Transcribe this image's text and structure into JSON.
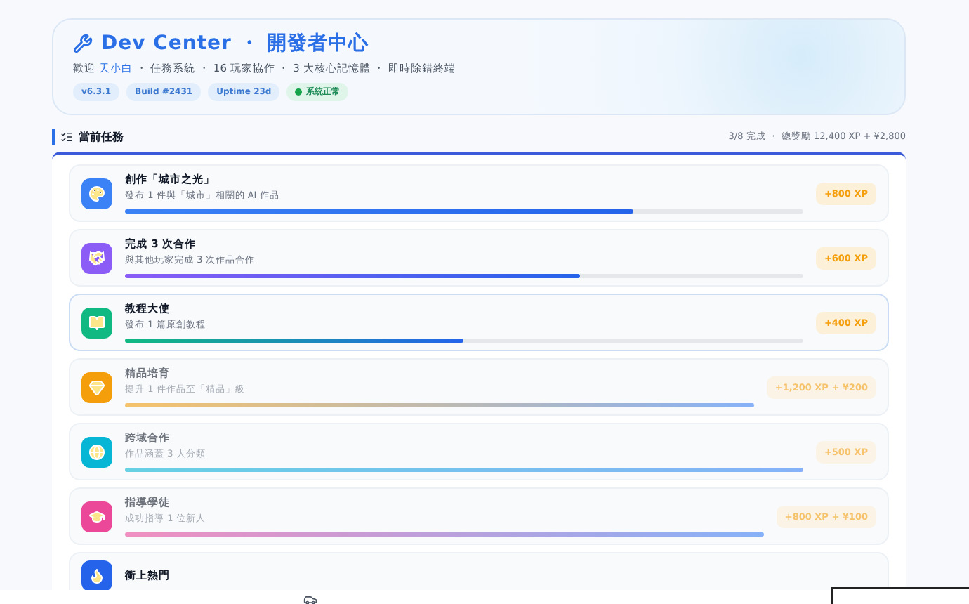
{
  "header": {
    "title": "Dev Center ・ 開發者中心",
    "greeting": "歡迎",
    "user": "天小白",
    "summary": "・ 任務系統 ・ 16 玩家協作 ・ 3 大核心記憶體 ・ 即時除錯終端",
    "chips": [
      {
        "label": "v6.3.1",
        "kind": "info"
      },
      {
        "label": "Build #2431",
        "kind": "info"
      },
      {
        "label": "Uptime 23d",
        "kind": "info"
      },
      {
        "label": "系統正常",
        "kind": "status"
      }
    ]
  },
  "section": {
    "title": "當前任務",
    "stats": "3/8 完成 ・ 總獎勵 12,400 XP + ¥2,800"
  },
  "tasks": [
    {
      "title": "創作「城市之光」",
      "desc": "發布 1 件與「城市」相關的 AI 作品",
      "reward": "+800 XP",
      "level": 0.75,
      "completed": false,
      "selected": false,
      "color": "#3b82f6"
    },
    {
      "title": "完成 3 次合作",
      "desc": "與其他玩家完成 3 次作品合作",
      "reward": "+600 XP",
      "level": 0.67,
      "completed": false,
      "selected": false,
      "color": "#8b5cf6"
    },
    {
      "title": "教程大使",
      "desc": "發布 1 篇原創教程",
      "reward": "+400 XP",
      "level": 0.5,
      "completed": false,
      "selected": true,
      "color": "#10b981"
    },
    {
      "title": "精品培育",
      "desc": "提升 1 件作品至「精品」級",
      "reward": "+1,200 XP + ¥200",
      "level": 1,
      "completed": true,
      "selected": false,
      "color": "#f59e0b"
    },
    {
      "title": "跨域合作",
      "desc": "作品涵蓋 3 大分類",
      "reward": "+500 XP",
      "level": 1,
      "completed": true,
      "selected": false,
      "color": "#06b6d4"
    },
    {
      "title": "指導學徒",
      "desc": "成功指導 1 位新人",
      "reward": "+800 XP + ¥100",
      "level": 1,
      "completed": true,
      "selected": false,
      "color": "#ec4899"
    },
    {
      "title": "衝上熱門",
      "completed": false,
      "selected": false,
      "color": "#2563eb"
    }
  ]
}
